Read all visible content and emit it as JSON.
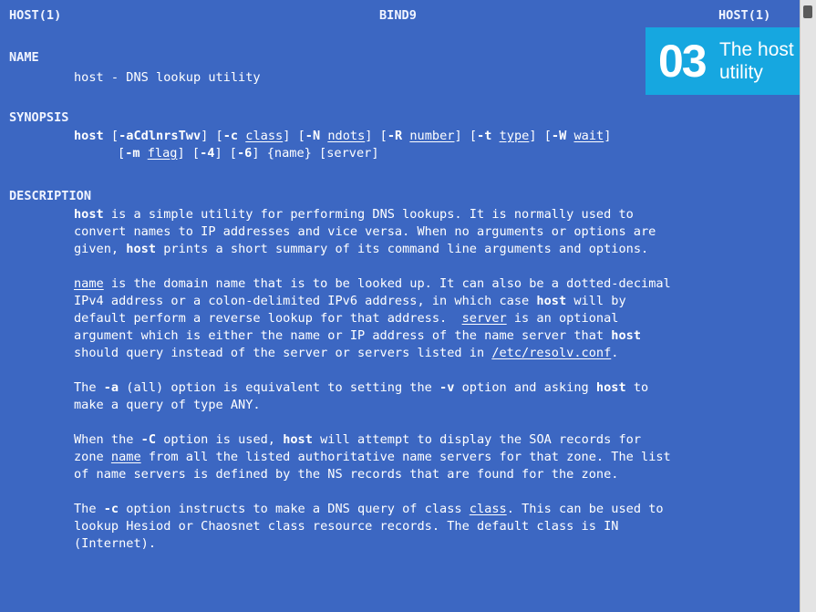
{
  "header": {
    "left": "HOST(1)",
    "center": "BIND9",
    "right": "HOST(1)"
  },
  "badge": {
    "number": "03",
    "line1": "The host",
    "line2": "utility"
  },
  "name_section": {
    "heading": "NAME",
    "text": "host - DNS lookup utility"
  },
  "synopsis": {
    "heading": "SYNOPSIS",
    "line1": [
      {
        "t": "host",
        "s": "b"
      },
      {
        "t": " ["
      },
      {
        "t": "-aCdlnrsTwv",
        "s": "b"
      },
      {
        "t": "] ["
      },
      {
        "t": "-c",
        "s": "b"
      },
      {
        "t": " "
      },
      {
        "t": "class",
        "s": "u"
      },
      {
        "t": "] ["
      },
      {
        "t": "-N",
        "s": "b"
      },
      {
        "t": " "
      },
      {
        "t": "ndots",
        "s": "u"
      },
      {
        "t": "] ["
      },
      {
        "t": "-R",
        "s": "b"
      },
      {
        "t": " "
      },
      {
        "t": "number",
        "s": "u"
      },
      {
        "t": "] ["
      },
      {
        "t": "-t",
        "s": "b"
      },
      {
        "t": " "
      },
      {
        "t": "type",
        "s": "u"
      },
      {
        "t": "] ["
      },
      {
        "t": "-W",
        "s": "b"
      },
      {
        "t": " "
      },
      {
        "t": "wait",
        "s": "u"
      },
      {
        "t": "]"
      }
    ],
    "line2": [
      {
        "t": "["
      },
      {
        "t": "-m",
        "s": "b"
      },
      {
        "t": " "
      },
      {
        "t": "flag",
        "s": "u"
      },
      {
        "t": "] ["
      },
      {
        "t": "-4",
        "s": "b"
      },
      {
        "t": "] ["
      },
      {
        "t": "-6",
        "s": "b"
      },
      {
        "t": "] {name} [server]"
      }
    ]
  },
  "description": {
    "heading": "DESCRIPTION",
    "lines": [
      [
        {
          "t": "host",
          "s": "b"
        },
        {
          "t": " is a simple utility for performing DNS lookups. It is normally used to"
        }
      ],
      [
        {
          "t": "convert names to IP addresses and vice versa. When no arguments or options are"
        }
      ],
      [
        {
          "t": "given, "
        },
        {
          "t": "host",
          "s": "b"
        },
        {
          "t": " prints a short summary of its command line arguments and options."
        }
      ],
      [],
      [
        {
          "t": "name",
          "s": "u"
        },
        {
          "t": " is the domain name that is to be looked up. It can also be a dotted-decimal"
        }
      ],
      [
        {
          "t": "IPv4 address or a colon-delimited IPv6 address, in which case "
        },
        {
          "t": "host",
          "s": "b"
        },
        {
          "t": " will by"
        }
      ],
      [
        {
          "t": "default perform a reverse lookup for that address.  "
        },
        {
          "t": "server",
          "s": "u"
        },
        {
          "t": " is an optional"
        }
      ],
      [
        {
          "t": "argument which is either the name or IP address of the name server that "
        },
        {
          "t": "host",
          "s": "b"
        }
      ],
      [
        {
          "t": "should query instead of the server or servers listed in "
        },
        {
          "t": "/etc/resolv.conf",
          "s": "u"
        },
        {
          "t": "."
        }
      ],
      [],
      [
        {
          "t": "The "
        },
        {
          "t": "-a",
          "s": "b"
        },
        {
          "t": " (all) option is equivalent to setting the "
        },
        {
          "t": "-v",
          "s": "b"
        },
        {
          "t": " option and asking "
        },
        {
          "t": "host",
          "s": "b"
        },
        {
          "t": " to"
        }
      ],
      [
        {
          "t": "make a query of type ANY."
        }
      ],
      [],
      [
        {
          "t": "When the "
        },
        {
          "t": "-C",
          "s": "b"
        },
        {
          "t": " option is used, "
        },
        {
          "t": "host",
          "s": "b"
        },
        {
          "t": " will attempt to display the SOA records for"
        }
      ],
      [
        {
          "t": "zone "
        },
        {
          "t": "name",
          "s": "u"
        },
        {
          "t": " from all the listed authoritative name servers for that zone. The list"
        }
      ],
      [
        {
          "t": "of name servers is defined by the NS records that are found for the zone."
        }
      ],
      [],
      [
        {
          "t": "The "
        },
        {
          "t": "-c",
          "s": "b"
        },
        {
          "t": " option instructs to make a DNS query of class "
        },
        {
          "t": "class",
          "s": "u"
        },
        {
          "t": ". This can be used to"
        }
      ],
      [
        {
          "t": "lookup Hesiod or Chaosnet class resource records. The default class is IN"
        }
      ],
      [
        {
          "t": "(Internet)."
        }
      ]
    ]
  }
}
